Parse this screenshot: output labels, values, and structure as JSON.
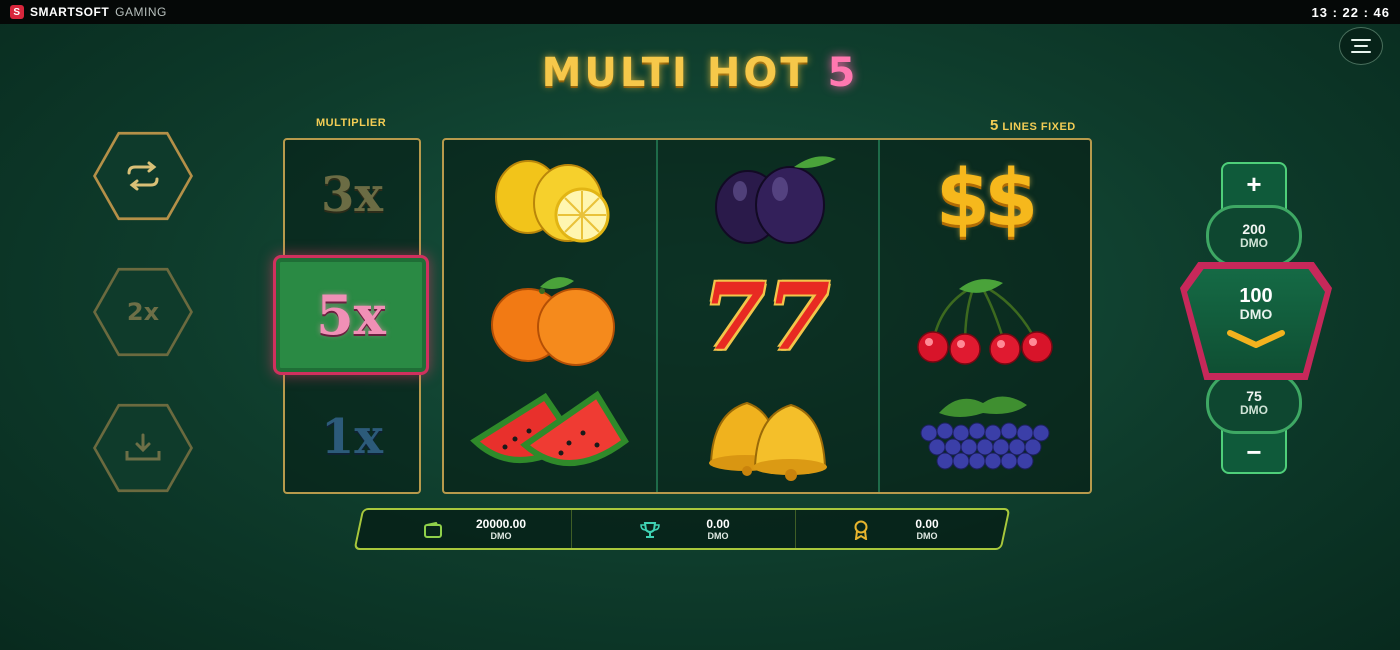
{
  "topbar": {
    "brand_bold": "SMARTSOFT",
    "brand_light": "GAMING",
    "clock": "13 : 22 : 46"
  },
  "title": {
    "main": "MULTI HOT",
    "number": "5"
  },
  "left_controls": {
    "multiplier_button_label": "2x"
  },
  "multiplier": {
    "label": "MULTIPLIER",
    "top": "3x",
    "active": "5x",
    "bottom": "1x"
  },
  "lines": {
    "number": "5",
    "label": "LINES FIXED"
  },
  "reels": [
    [
      "lemon",
      "orange",
      "watermelon"
    ],
    [
      "plum",
      "seven",
      "bell"
    ],
    [
      "dollar",
      "cherry",
      "grapes"
    ]
  ],
  "seven_text": "77",
  "dollar_text": "$$",
  "info": {
    "balance": {
      "value": "20000.00",
      "currency": "DMO",
      "icon": "wallet-icon"
    },
    "win": {
      "value": "0.00",
      "currency": "DMO",
      "icon": "trophy-icon"
    },
    "bonus": {
      "value": "0.00",
      "currency": "DMO",
      "icon": "medal-icon"
    }
  },
  "bet": {
    "plus": "+",
    "minus": "−",
    "upper": {
      "value": "200",
      "currency": "DMO"
    },
    "current": {
      "value": "100",
      "currency": "DMO"
    },
    "lower": {
      "value": "75",
      "currency": "DMO"
    }
  },
  "colors": {
    "gold": "#f3cd55",
    "accent_pink": "#d0305e",
    "green_frame": "#4fcf7a"
  }
}
